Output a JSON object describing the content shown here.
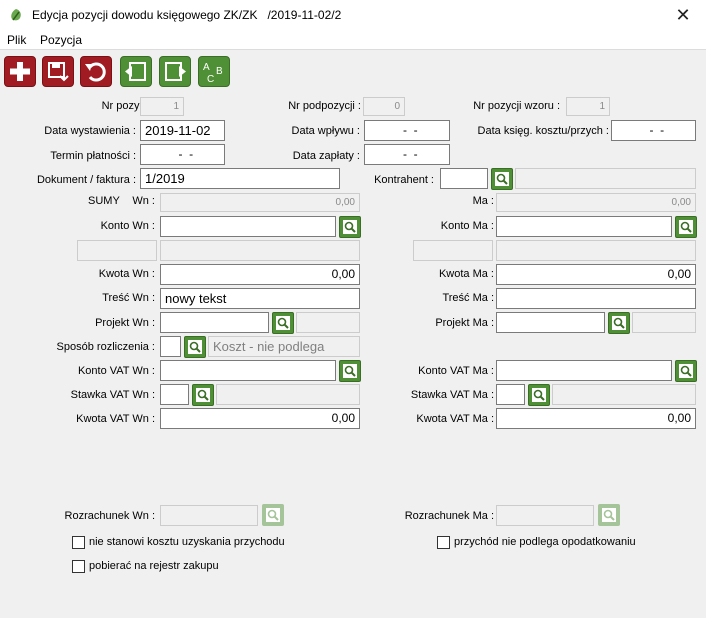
{
  "window": {
    "title": "Edycja pozycji dowodu księgowego ZK/ZK   /2019-11-02/2",
    "close_glyph": "✕"
  },
  "menu": [
    "Plik",
    "Pozycja"
  ],
  "toolbar": [
    "plus-icon",
    "save-icon",
    "undo-icon",
    "prev-icon",
    "next-icon",
    "spellcheck-icon"
  ],
  "header": {
    "nr_pozycji": {
      "label": "Nr pozycji :",
      "value": "1"
    },
    "nr_podpozycji": {
      "label": "Nr podpozycji :",
      "value": "0"
    },
    "nr_pozycji_wzoru": {
      "label": "Nr pozycji wzoru :",
      "value": "1"
    },
    "data_wystawienia": {
      "label": "Data wystawienia :",
      "value": "2019-11-02"
    },
    "data_wplywu": {
      "label": "Data wpływu :",
      "value": "  -  -"
    },
    "data_ksieg": {
      "label": "Data księg. kosztu/przych :",
      "value": "  -  -"
    },
    "termin_platnosci": {
      "label": "Termin płatności :",
      "value": "  -  -"
    },
    "data_zaplaty": {
      "label": "Data zapłaty :",
      "value": "  -  -"
    },
    "dokument": {
      "label": "Dokument / faktura :",
      "value": "1/2019"
    },
    "kontrahent": {
      "label": "Kontrahent :",
      "value": ""
    }
  },
  "wn": {
    "sumy_label": "SUMY",
    "sumy_wn_label": "Wn :",
    "sumy_value": "0,00",
    "konto_label": "Konto Wn :",
    "kwota_label": "Kwota Wn :",
    "kwota_value": "0,00",
    "tresc_label": "Treść Wn :",
    "tresc_value": "nowy tekst",
    "projekt_label": "Projekt Wn :",
    "sposob_label": "Sposób rozliczenia :",
    "sposob_value": "Koszt - nie podlega",
    "konto_vat_label": "Konto VAT Wn :",
    "stawka_vat_label": "Stawka VAT Wn :",
    "kwota_vat_label": "Kwota VAT Wn :",
    "kwota_vat_value": "0,00",
    "rozrachunek_label": "Rozrachunek Wn :"
  },
  "ma": {
    "sumy_ma_label": "Ma :",
    "sumy_value": "0,00",
    "konto_label": "Konto Ma :",
    "kwota_label": "Kwota Ma :",
    "kwota_value": "0,00",
    "tresc_label": "Treść Ma :",
    "tresc_value": "",
    "projekt_label": "Projekt Ma :",
    "konto_vat_label": "Konto VAT Ma :",
    "stawka_vat_label": "Stawka VAT Ma :",
    "kwota_vat_label": "Kwota VAT Ma :",
    "kwota_vat_value": "0,00",
    "rozrachunek_label": "Rozrachunek Ma :"
  },
  "checkboxes": {
    "nie_stanowi": {
      "label": "nie stanowi kosztu uzyskania przychodu",
      "checked": false
    },
    "przychod": {
      "label": "przychód nie podlega opodatkowaniu",
      "checked": false
    },
    "pobierac": {
      "label": "pobierać na rejestr zakupu",
      "checked": false
    }
  },
  "colors": {
    "red_button": "#a01c22",
    "green_button": "#4f8f35"
  }
}
